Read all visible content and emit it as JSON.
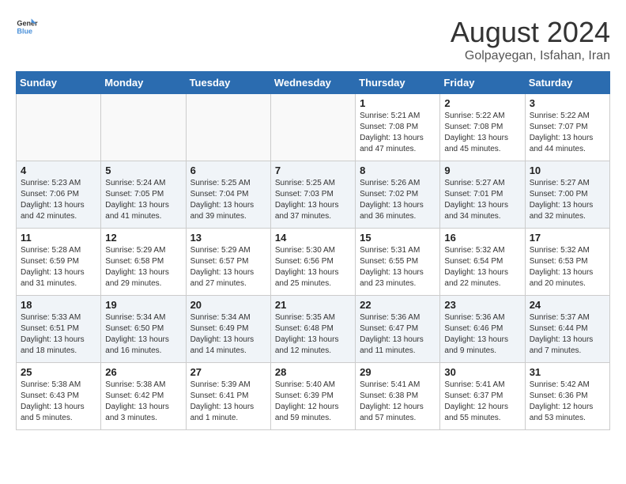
{
  "logo": {
    "line1": "General",
    "line2": "Blue"
  },
  "title": "August 2024",
  "subtitle": "Golpayegan, Isfahan, Iran",
  "days_of_week": [
    "Sunday",
    "Monday",
    "Tuesday",
    "Wednesday",
    "Thursday",
    "Friday",
    "Saturday"
  ],
  "weeks": [
    [
      {
        "num": "",
        "info": ""
      },
      {
        "num": "",
        "info": ""
      },
      {
        "num": "",
        "info": ""
      },
      {
        "num": "",
        "info": ""
      },
      {
        "num": "1",
        "info": "Sunrise: 5:21 AM\nSunset: 7:08 PM\nDaylight: 13 hours\nand 47 minutes."
      },
      {
        "num": "2",
        "info": "Sunrise: 5:22 AM\nSunset: 7:08 PM\nDaylight: 13 hours\nand 45 minutes."
      },
      {
        "num": "3",
        "info": "Sunrise: 5:22 AM\nSunset: 7:07 PM\nDaylight: 13 hours\nand 44 minutes."
      }
    ],
    [
      {
        "num": "4",
        "info": "Sunrise: 5:23 AM\nSunset: 7:06 PM\nDaylight: 13 hours\nand 42 minutes."
      },
      {
        "num": "5",
        "info": "Sunrise: 5:24 AM\nSunset: 7:05 PM\nDaylight: 13 hours\nand 41 minutes."
      },
      {
        "num": "6",
        "info": "Sunrise: 5:25 AM\nSunset: 7:04 PM\nDaylight: 13 hours\nand 39 minutes."
      },
      {
        "num": "7",
        "info": "Sunrise: 5:25 AM\nSunset: 7:03 PM\nDaylight: 13 hours\nand 37 minutes."
      },
      {
        "num": "8",
        "info": "Sunrise: 5:26 AM\nSunset: 7:02 PM\nDaylight: 13 hours\nand 36 minutes."
      },
      {
        "num": "9",
        "info": "Sunrise: 5:27 AM\nSunset: 7:01 PM\nDaylight: 13 hours\nand 34 minutes."
      },
      {
        "num": "10",
        "info": "Sunrise: 5:27 AM\nSunset: 7:00 PM\nDaylight: 13 hours\nand 32 minutes."
      }
    ],
    [
      {
        "num": "11",
        "info": "Sunrise: 5:28 AM\nSunset: 6:59 PM\nDaylight: 13 hours\nand 31 minutes."
      },
      {
        "num": "12",
        "info": "Sunrise: 5:29 AM\nSunset: 6:58 PM\nDaylight: 13 hours\nand 29 minutes."
      },
      {
        "num": "13",
        "info": "Sunrise: 5:29 AM\nSunset: 6:57 PM\nDaylight: 13 hours\nand 27 minutes."
      },
      {
        "num": "14",
        "info": "Sunrise: 5:30 AM\nSunset: 6:56 PM\nDaylight: 13 hours\nand 25 minutes."
      },
      {
        "num": "15",
        "info": "Sunrise: 5:31 AM\nSunset: 6:55 PM\nDaylight: 13 hours\nand 23 minutes."
      },
      {
        "num": "16",
        "info": "Sunrise: 5:32 AM\nSunset: 6:54 PM\nDaylight: 13 hours\nand 22 minutes."
      },
      {
        "num": "17",
        "info": "Sunrise: 5:32 AM\nSunset: 6:53 PM\nDaylight: 13 hours\nand 20 minutes."
      }
    ],
    [
      {
        "num": "18",
        "info": "Sunrise: 5:33 AM\nSunset: 6:51 PM\nDaylight: 13 hours\nand 18 minutes."
      },
      {
        "num": "19",
        "info": "Sunrise: 5:34 AM\nSunset: 6:50 PM\nDaylight: 13 hours\nand 16 minutes."
      },
      {
        "num": "20",
        "info": "Sunrise: 5:34 AM\nSunset: 6:49 PM\nDaylight: 13 hours\nand 14 minutes."
      },
      {
        "num": "21",
        "info": "Sunrise: 5:35 AM\nSunset: 6:48 PM\nDaylight: 13 hours\nand 12 minutes."
      },
      {
        "num": "22",
        "info": "Sunrise: 5:36 AM\nSunset: 6:47 PM\nDaylight: 13 hours\nand 11 minutes."
      },
      {
        "num": "23",
        "info": "Sunrise: 5:36 AM\nSunset: 6:46 PM\nDaylight: 13 hours\nand 9 minutes."
      },
      {
        "num": "24",
        "info": "Sunrise: 5:37 AM\nSunset: 6:44 PM\nDaylight: 13 hours\nand 7 minutes."
      }
    ],
    [
      {
        "num": "25",
        "info": "Sunrise: 5:38 AM\nSunset: 6:43 PM\nDaylight: 13 hours\nand 5 minutes."
      },
      {
        "num": "26",
        "info": "Sunrise: 5:38 AM\nSunset: 6:42 PM\nDaylight: 13 hours\nand 3 minutes."
      },
      {
        "num": "27",
        "info": "Sunrise: 5:39 AM\nSunset: 6:41 PM\nDaylight: 13 hours\nand 1 minute."
      },
      {
        "num": "28",
        "info": "Sunrise: 5:40 AM\nSunset: 6:39 PM\nDaylight: 12 hours\nand 59 minutes."
      },
      {
        "num": "29",
        "info": "Sunrise: 5:41 AM\nSunset: 6:38 PM\nDaylight: 12 hours\nand 57 minutes."
      },
      {
        "num": "30",
        "info": "Sunrise: 5:41 AM\nSunset: 6:37 PM\nDaylight: 12 hours\nand 55 minutes."
      },
      {
        "num": "31",
        "info": "Sunrise: 5:42 AM\nSunset: 6:36 PM\nDaylight: 12 hours\nand 53 minutes."
      }
    ]
  ]
}
